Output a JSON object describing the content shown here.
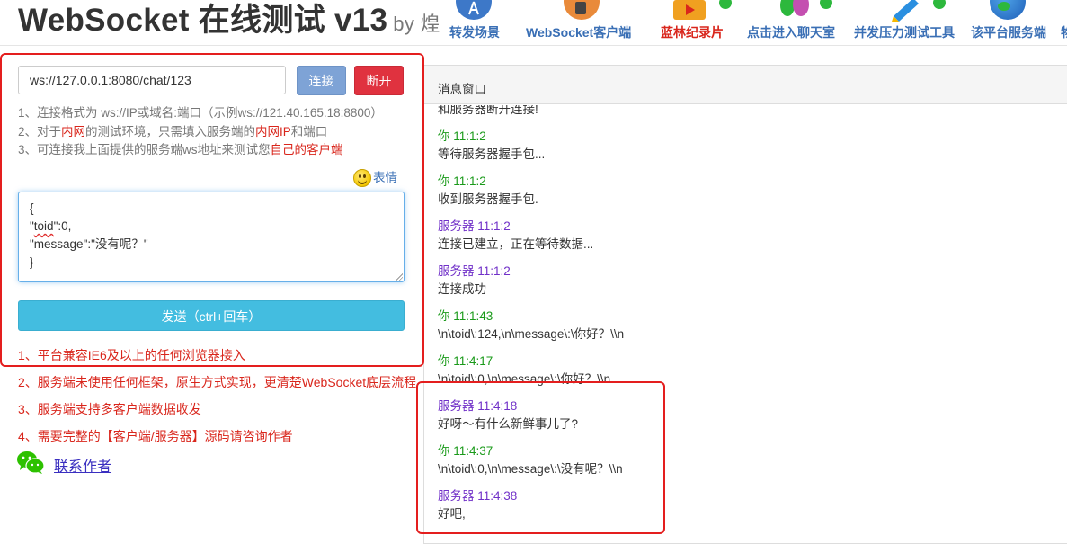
{
  "header": {
    "title": "WebSocket 在线测试 v13",
    "by": "by 煌",
    "nav": [
      {
        "label": "转发场景",
        "icon": "forward-icon",
        "color": "#3a6fb5"
      },
      {
        "label": "WebSocket客户端",
        "icon": "client-icon",
        "color": "#3a6fb5"
      },
      {
        "label": "蓝林纪录片",
        "icon": "video-icon",
        "color": "#d9261c"
      },
      {
        "label": "点击进入聊天室",
        "icon": "chatroom-icon",
        "color": "#3a6fb5"
      },
      {
        "label": "并发压力测试工具",
        "icon": "stress-test-icon",
        "color": "#3a6fb5"
      },
      {
        "label": "该平台服务端",
        "icon": "server-globe-icon",
        "color": "#3a6fb5"
      },
      {
        "label": "物",
        "icon": "more-icon",
        "color": "#3a6fb5"
      }
    ]
  },
  "connection": {
    "url_value": "ws://127.0.0.1:8080/chat/123",
    "connect_label": "连接",
    "disconnect_label": "断开"
  },
  "hints": {
    "h1": "1、连接格式为 ws://IP或域名:端口（示例ws://121.40.165.18:8800）",
    "h2a": "2、对于",
    "h2b": "内网",
    "h2c": "的测试环境，只需填入服务端的",
    "h2d": "内网IP",
    "h2e": "和端口",
    "h3a": "3、可连接我上面提供的服务端ws地址来测试您",
    "h3b": "自己的客户端"
  },
  "composer": {
    "emoji_label": "表情",
    "line1": "{",
    "line2_key": "toid",
    "line2_rest": "\":0,",
    "line2_open": "\"",
    "line3": "\"message\":\"没有呢？\"",
    "line4": "}",
    "send_label": "发送（ctrl+回车）"
  },
  "features": [
    "1、平台兼容IE6及以上的任何浏览器接入",
    "2、服务端未使用任何框架，原生方式实现，更清楚WebSocket底层流程",
    "3、服务端支持多客户端数据收发",
    "4、需要完整的【客户端/服务器】源码请咨询作者"
  ],
  "contact_label": "联系作者",
  "message_panel": {
    "title": "消息窗口",
    "partial_top": "和服务器断开连接!",
    "messages": [
      {
        "sender": "你 11:1:2",
        "type": "you",
        "text": "等待服务器握手包..."
      },
      {
        "sender": "你 11:1:2",
        "type": "you",
        "text": "收到服务器握手包."
      },
      {
        "sender": "服务器 11:1:2",
        "type": "srv",
        "text": "连接已建立，正在等待数据..."
      },
      {
        "sender": "服务器 11:1:2",
        "type": "srv",
        "text": "连接成功"
      },
      {
        "sender": "你 11:1:43",
        "type": "you",
        "text": "\\n\\toid\\:124,\\n\\message\\:\\你好？\\\\n"
      },
      {
        "sender": "你 11:4:17",
        "type": "you",
        "text": "\\n\\toid\\:0,\\n\\message\\:\\你好？\\\\n"
      },
      {
        "sender": "服务器 11:4:18",
        "type": "srv",
        "text": "好呀～有什么新鲜事儿了?"
      },
      {
        "sender": "你 11:4:37",
        "type": "you",
        "text": "\\n\\toid\\:0,\\n\\message\\:\\没有呢？\\\\n"
      },
      {
        "sender": "服务器 11:4:38",
        "type": "srv",
        "text": "好吧,"
      }
    ]
  },
  "colors": {
    "you": "#1a9a1a",
    "server": "#7030c8",
    "annotation_red": "#e41e1e",
    "connect_btn": "#7ea3d6",
    "disconnect_btn": "#e0323f",
    "send_btn": "#43bde0"
  }
}
